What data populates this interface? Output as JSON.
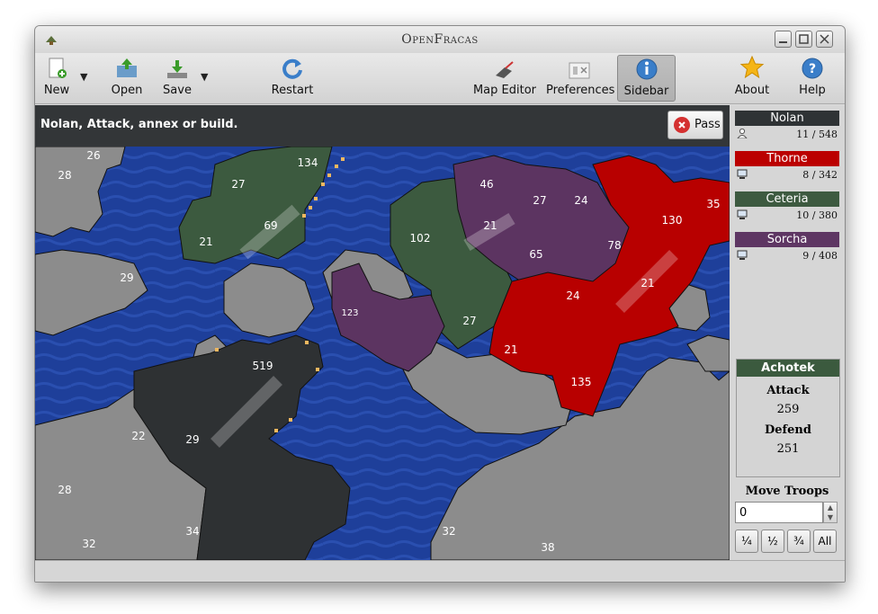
{
  "window": {
    "title": "OpenFracas"
  },
  "toolbar": {
    "new": "New",
    "open": "Open",
    "save": "Save",
    "restart": "Restart",
    "map_editor": "Map Editor",
    "preferences": "Preferences",
    "sidebar": "Sidebar",
    "about": "About",
    "help": "Help"
  },
  "status": {
    "message": "Nolan, Attack, annex or build.",
    "pass_label": "Pass"
  },
  "players": [
    {
      "name": "Nolan",
      "stats": "11 / 548",
      "color": "#2f3335",
      "type": "human"
    },
    {
      "name": "Thorne",
      "stats": "8 / 342",
      "color": "#bb0000",
      "type": "computer"
    },
    {
      "name": "Ceteria",
      "stats": "10 / 380",
      "color": "#3d5a40",
      "type": "computer"
    },
    {
      "name": "Sorcha",
      "stats": "9 / 408",
      "color": "#5e3663",
      "type": "computer"
    }
  ],
  "region": {
    "name": "Achotek",
    "attack_label": "Attack",
    "attack": "259",
    "defend_label": "Defend",
    "defend": "251"
  },
  "move": {
    "title": "Move Troops",
    "value": "0",
    "quarter": "¼",
    "half": "½",
    "three_quarter": "¾",
    "all": "All"
  },
  "map": {
    "colors": {
      "ocean": "#1e3f9a",
      "neutral": "#8c8c8c",
      "nolan": "#2e3133",
      "thorne": "#b80000",
      "ceteria": "#3c5a3f",
      "sorcha": "#5c3461"
    },
    "labels": [
      "26",
      "28",
      "27",
      "134",
      "69",
      "21",
      "29",
      "46",
      "27",
      "24",
      "21",
      "102",
      "65",
      "78",
      "130",
      "35",
      "21",
      "24",
      "123",
      "27",
      "21",
      "135",
      "519",
      "22",
      "29",
      "28",
      "34",
      "32",
      "32",
      "38"
    ]
  }
}
